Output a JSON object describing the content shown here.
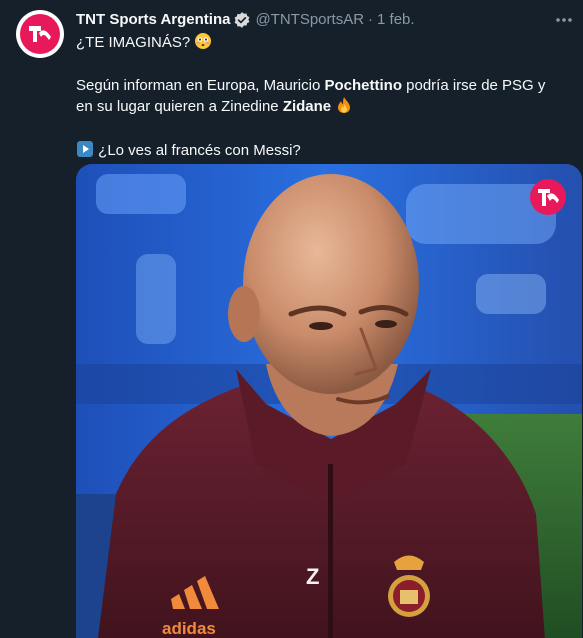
{
  "tweet": {
    "display_name": "TNT Sports Argentina",
    "handle": "@TNTSportsAR",
    "separator": "·",
    "date": "1 feb.",
    "line1": "¿TE IMAGINÁS?",
    "para2_a": "Según informan en Europa, Mauricio ",
    "para2_b": "Pochettino",
    "para2_c": " podría irse de PSG y en su lugar quieren a Zinedine ",
    "para2_d": "Zidane",
    "para3": "¿Lo ves al francés con Messi?"
  },
  "media": {
    "jacket_brand": "adidas",
    "jacket_initials": "Z Z",
    "sleeve_letter": "Z"
  },
  "icons": {
    "avatar": "tnt-logo-icon",
    "verified": "verified-badge-icon",
    "more": "more-options-icon",
    "flushed_face": "flushed-face-emoji",
    "fire": "fire-emoji",
    "play_button": "play-button-emoji"
  },
  "colors": {
    "background": "#15202b",
    "text": "#f7f9f9",
    "secondary_text": "#8b98a5",
    "brand_pink": "#e8195a"
  }
}
